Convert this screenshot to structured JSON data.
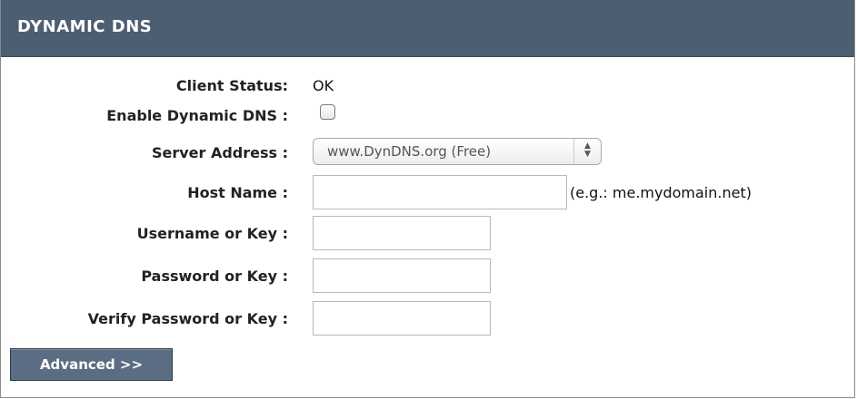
{
  "section": {
    "title": "DYNAMIC DNS"
  },
  "fields": {
    "client_status": {
      "label": "Client Status:",
      "value": "OK"
    },
    "enable_ddns": {
      "label": "Enable Dynamic DNS :",
      "checked": false
    },
    "server_address": {
      "label": "Server Address :",
      "selected": "www.DynDNS.org (Free)"
    },
    "host_name": {
      "label": "Host Name :",
      "value": "",
      "hint": "(e.g.: me.mydomain.net)"
    },
    "username": {
      "label": "Username or Key :",
      "value": ""
    },
    "password": {
      "label": "Password or Key :",
      "value": ""
    },
    "verify_password": {
      "label": "Verify Password or Key :",
      "value": ""
    }
  },
  "buttons": {
    "advanced_label": "Advanced >>"
  },
  "colors": {
    "header_bg": "#4b5e72",
    "button_bg": "#5a6d82"
  }
}
